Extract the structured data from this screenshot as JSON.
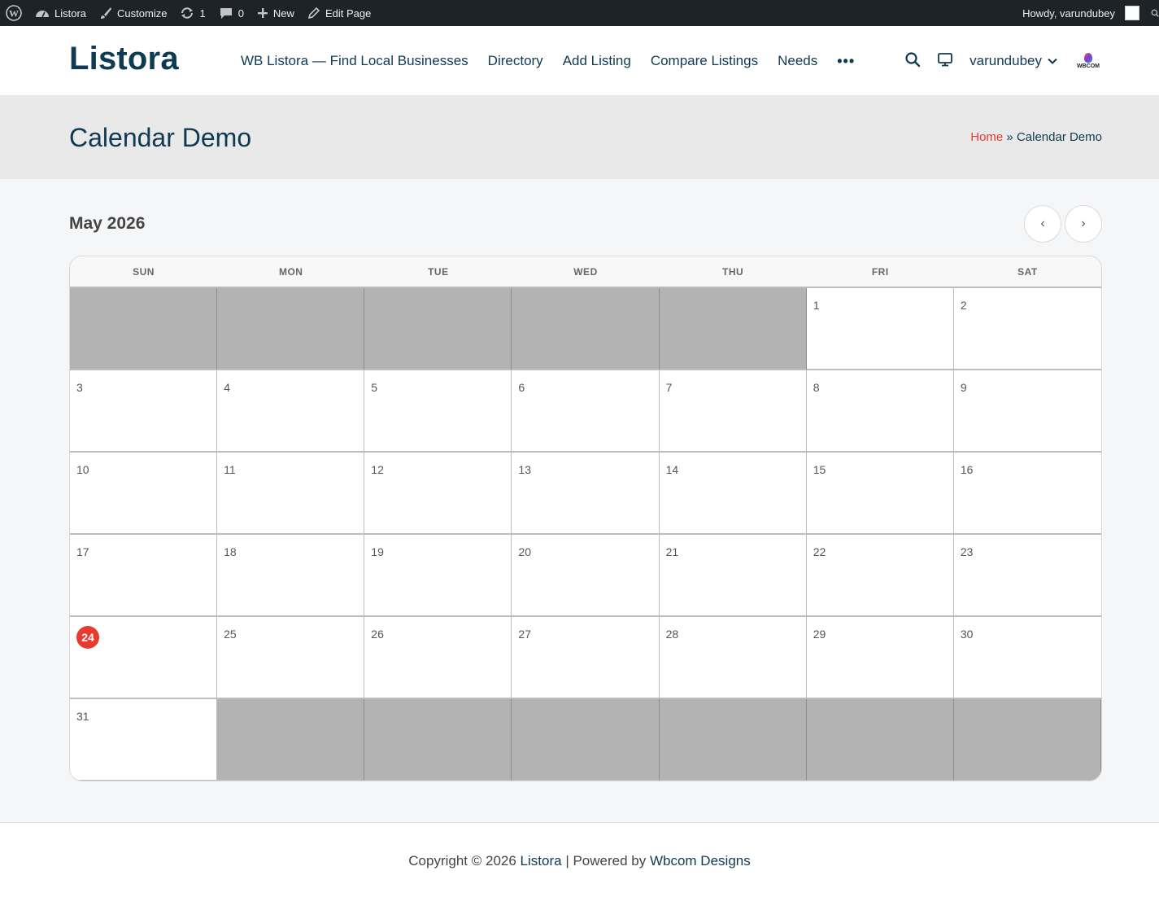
{
  "admin_bar": {
    "site_name": "Listora",
    "customize": "Customize",
    "updates_count": "1",
    "comments_count": "0",
    "new_label": "New",
    "edit_label": "Edit Page",
    "howdy": "Howdy, varundubey"
  },
  "header": {
    "logo": "Listora",
    "nav": [
      "WB Listora — Find Local Businesses",
      "Directory",
      "Add Listing",
      "Compare Listings",
      "Needs"
    ],
    "more": "•••",
    "username": "varundubey",
    "brand_logo_text": "WBCOM"
  },
  "page": {
    "title": "Calendar Demo",
    "breadcrumb_home": "Home",
    "breadcrumb_sep": "»",
    "breadcrumb_current": "Calendar Demo"
  },
  "calendar": {
    "month": "May 2026",
    "prev": "‹",
    "next": "›",
    "weekdays": [
      "SUN",
      "MON",
      "TUE",
      "WED",
      "THU",
      "FRI",
      "SAT"
    ],
    "cells": [
      "",
      "",
      "",
      "",
      "",
      "1",
      "2",
      "3",
      "4",
      "5",
      "6",
      "7",
      "8",
      "9",
      "10",
      "11",
      "12",
      "13",
      "14",
      "15",
      "16",
      "17",
      "18",
      "19",
      "20",
      "21",
      "22",
      "23",
      "24",
      "25",
      "26",
      "27",
      "28",
      "29",
      "30",
      "31",
      "",
      "",
      "",
      "",
      "",
      ""
    ],
    "today": "24"
  },
  "footer": {
    "prefix": "Copyright © 2026",
    "site_link": "Listora",
    "separator": "| Powered by",
    "credit_link": "Wbcom Designs"
  },
  "colors": {
    "accent": "#e63b2e",
    "brand": "#0e3a52",
    "adminbar": "#1d2327"
  }
}
